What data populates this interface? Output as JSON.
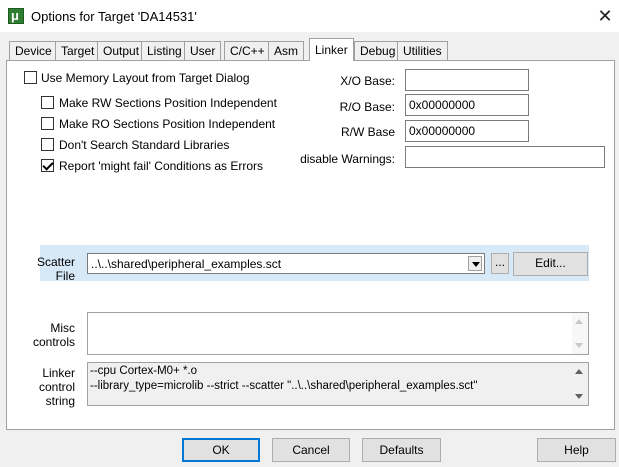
{
  "window": {
    "title": "Options for Target 'DA14531'",
    "icon_glyph": "μ",
    "close_glyph": "✕"
  },
  "tabs": [
    {
      "label": "Device"
    },
    {
      "label": "Target"
    },
    {
      "label": "Output"
    },
    {
      "label": "Listing"
    },
    {
      "label": "User"
    },
    {
      "label": "C/C++"
    },
    {
      "label": "Asm"
    },
    {
      "label": "Linker",
      "active": true
    },
    {
      "label": "Debug"
    },
    {
      "label": "Utilities"
    }
  ],
  "options": {
    "use_memory_layout": {
      "label": "Use Memory Layout from Target Dialog",
      "checked": false
    },
    "make_rw": {
      "label": "Make RW Sections Position Independent",
      "checked": false
    },
    "make_ro": {
      "label": "Make RO Sections Position Independent",
      "checked": false
    },
    "dont_search": {
      "label": "Don't Search Standard Libraries",
      "checked": false
    },
    "report_might_fail": {
      "label": "Report 'might fail' Conditions as Errors",
      "checked": true
    }
  },
  "bases": {
    "xo": {
      "label": "X/O Base:",
      "value": ""
    },
    "ro": {
      "label": "R/O Base:",
      "value": "0x00000000"
    },
    "rw": {
      "label": "R/W Base",
      "value": "0x00000000"
    },
    "warnings": {
      "label": "disable Warnings:",
      "value": ""
    }
  },
  "scatter": {
    "label_line1": "Scatter",
    "label_line2": "File",
    "value": "..\\..\\shared\\peripheral_examples.sct",
    "browse_label": "...",
    "edit_label": "Edit..."
  },
  "misc": {
    "label_line1": "Misc",
    "label_line2": "controls",
    "value": ""
  },
  "linker_control": {
    "label_line1": "Linker",
    "label_line2": "control",
    "label_line3": "string",
    "line1": "--cpu Cortex-M0+ *.o",
    "line2": "--library_type=microlib --strict --scatter \"..\\..\\shared\\peripheral_examples.sct\""
  },
  "buttons": {
    "ok": "OK",
    "cancel": "Cancel",
    "defaults": "Defaults",
    "help": "Help"
  },
  "colors": {
    "scatter_highlight": "#d7e8f7",
    "default_button_border": "#0078d7",
    "app_icon": "#2f7d31"
  }
}
